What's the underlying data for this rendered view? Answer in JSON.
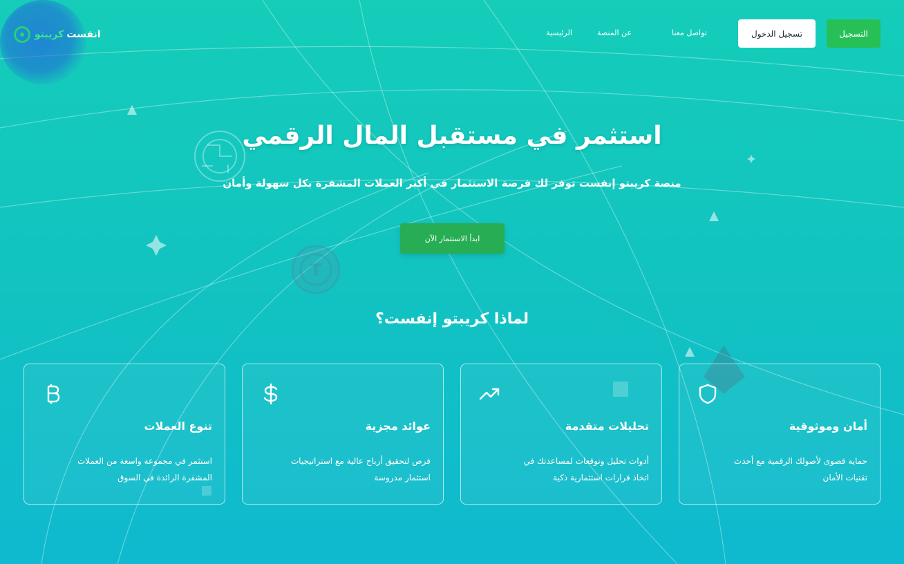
{
  "brand": {
    "name_part1": "انفست",
    "name_part2": "كريبتو",
    "logo_icon": "coin-c-icon"
  },
  "nav": {
    "home": "الرئيسية",
    "about": "عن المنصة",
    "contact": "تواصل معنا",
    "login": "تسجيل الدخول",
    "register": "التسجيل"
  },
  "hero": {
    "title": "استثمر في مستقبل المال الرقمي",
    "subtitle": "منصة كريبتو إنفست توفر لك فرصة الاستثمار في أكبر العملات المشفرة بكل سهولة وأمان",
    "cta": "ابدأ الاستثمار الآن"
  },
  "why": {
    "title": "لماذا كريبتو إنفست؟",
    "cards": [
      {
        "icon": "shield-icon",
        "title": "أمان وموثوقية",
        "line1": "حماية قصوى لأصولك الرقمية مع أحدث",
        "line2": "تقنيات الأمان"
      },
      {
        "icon": "trending-up-icon",
        "title": "تحليلات متقدمة",
        "line1": "أدوات تحليل وتوقعات لمساعدتك في",
        "line2": "اتخاذ قرارات استثمارية ذكية"
      },
      {
        "icon": "dollar-icon",
        "title": "عوائد مجزية",
        "line1": "فرص لتحقيق أرباح عالية مع استراتيجيات",
        "line2": "استثمار مدروسة"
      },
      {
        "icon": "bitcoin-icon",
        "title": "تنوع العملات",
        "line1": "استثمر في مجموعة واسعة من العملات",
        "line2": "المشفرة الرائدة في السوق"
      }
    ]
  },
  "colors": {
    "accent_green": "#27c057",
    "bg_top": "#15cdb9",
    "bg_bottom": "#0fb9cf"
  }
}
